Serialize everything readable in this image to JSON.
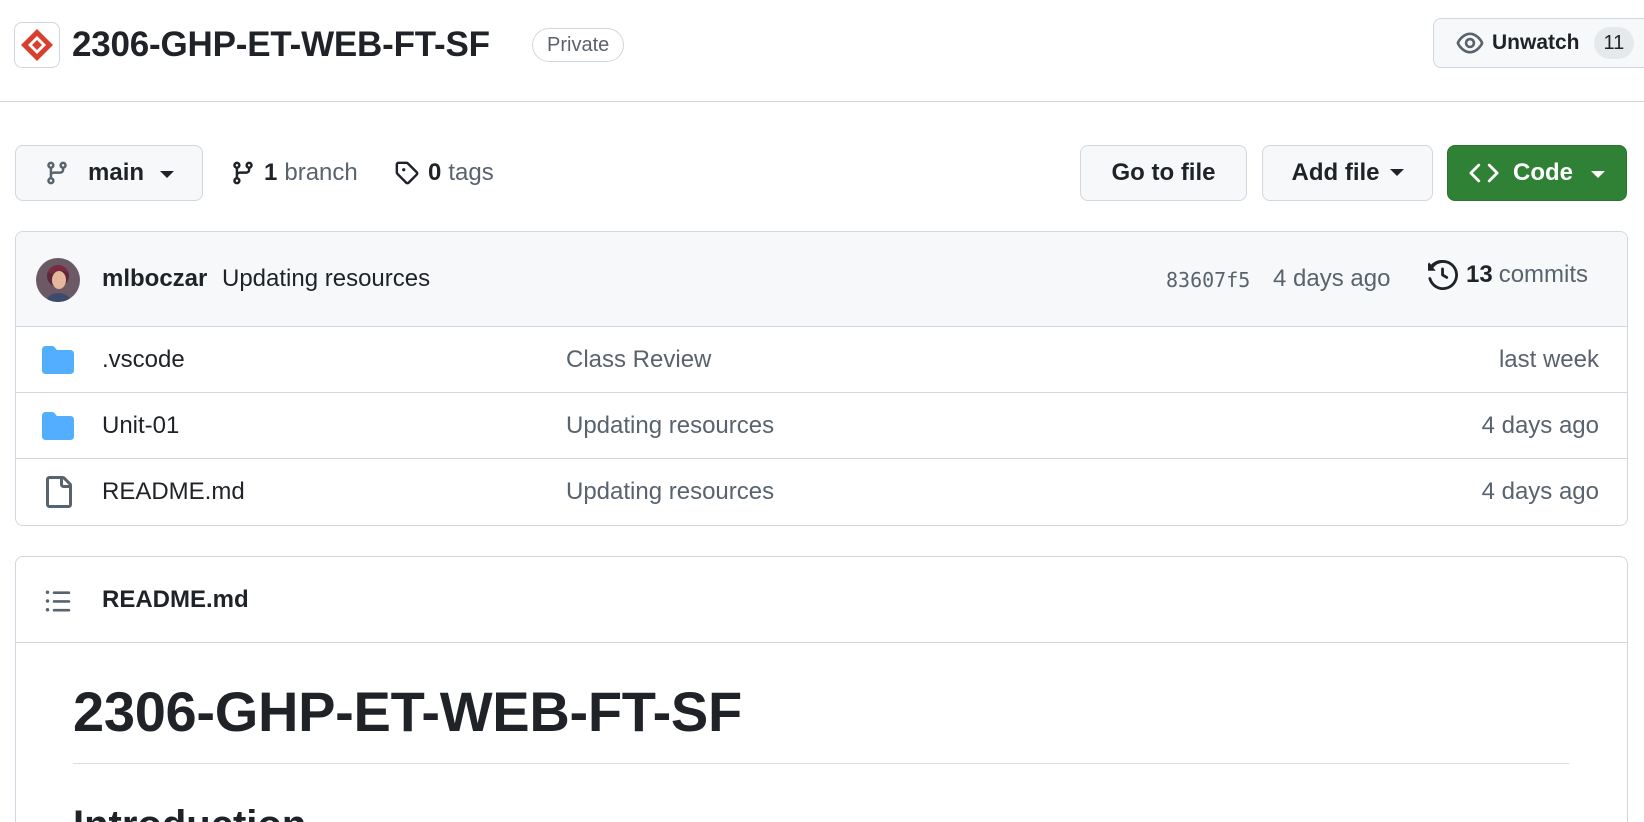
{
  "repo": {
    "name": "2306-GHP-ET-WEB-FT-SF",
    "visibility": "Private",
    "org_logo_icon": "diamond-logo-icon",
    "brand_color": "#d93f2f"
  },
  "watch": {
    "label": "Unwatch",
    "count": "11",
    "icon": "eye-icon"
  },
  "toolbar": {
    "branch": "main",
    "branch_count": "1",
    "branch_label": "branch",
    "tag_count": "0",
    "tag_label": "tags",
    "go_to_file": "Go to file",
    "add_file": "Add file",
    "code": "Code",
    "code_color": "#2f8135"
  },
  "latest_commit": {
    "author": "mlboczar",
    "message": "Updating resources",
    "sha": "83607f5",
    "time": "4 days ago",
    "commit_count": "13",
    "commit_label": "commits"
  },
  "files": [
    {
      "type": "folder",
      "icon": "folder-icon",
      "name": ".vscode",
      "message": "Class Review",
      "time": "last week"
    },
    {
      "type": "folder",
      "icon": "folder-icon",
      "name": "Unit-01",
      "message": "Updating resources",
      "time": "4 days ago"
    },
    {
      "type": "file",
      "icon": "file-icon",
      "name": "README.md",
      "message": "Updating resources",
      "time": "4 days ago"
    }
  ],
  "readme": {
    "filename": "README.md",
    "heading": "2306-GHP-ET-WEB-FT-SF",
    "subheading": "Introduction"
  }
}
